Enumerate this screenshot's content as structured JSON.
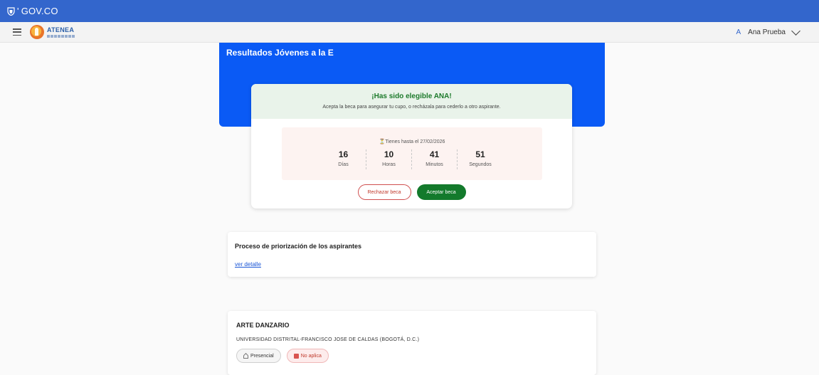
{
  "gov": {
    "logo_text": "GOV.CO",
    "apostrophe": "'"
  },
  "app": {
    "brand_name": "ATENEA",
    "user_initial": "A",
    "user_name": "Ana Prueba"
  },
  "hero": {
    "title": "Resultados Jóvenes a la E"
  },
  "eligibility": {
    "title": "¡Has sido elegible ANA!",
    "subtitle": "Acepta la beca para asegurar tu cupo, o recházala para cederlo a otro aspirante.",
    "deadline_text": "Tienes hasta el 27/02/2026",
    "countdown": [
      {
        "value": "16",
        "label": "Días"
      },
      {
        "value": "10",
        "label": "Horas"
      },
      {
        "value": "41",
        "label": "Minutos"
      },
      {
        "value": "51",
        "label": "Segundos"
      }
    ],
    "reject_label": "Rechazar beca",
    "accept_label": "Aceptar beca"
  },
  "priority": {
    "title": "Proceso de priorización de los aspirantes",
    "link": "ver detalle"
  },
  "program": {
    "title": "ARTE DANZARIO",
    "university": "UNIVERSIDAD DISTRITAL-FRANCISCO JOSE DE CALDAS (BOGOTÁ, D.C.)",
    "modality": "Presencial",
    "status": "No aplica"
  },
  "colors": {
    "gov_bar": "#3366cc",
    "hero": "#0a5af5",
    "accept": "#137a2c",
    "reject": "#c0392b",
    "link": "#1a56d6"
  }
}
